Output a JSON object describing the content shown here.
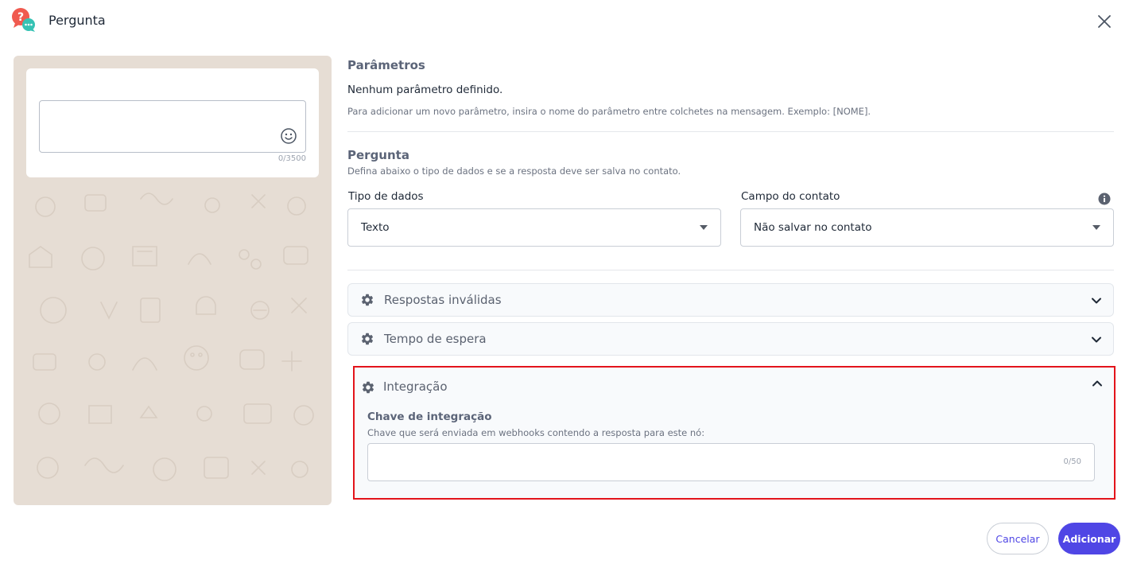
{
  "header": {
    "title": "Pergunta",
    "app_icon": "question-chat-icon",
    "close_icon": "close-icon"
  },
  "preview": {
    "message_counter": "0/3500",
    "emoji_icon": "smiley-icon"
  },
  "parameters": {
    "title": "Parâmetros",
    "empty_text": "Nenhum parâmetro definido.",
    "hint": "Para adicionar um novo parâmetro, insira o nome do parâmetro entre colchetes na mensagem. Exemplo: [NOME]."
  },
  "question": {
    "title": "Pergunta",
    "subtitle": "Defina abaixo o tipo de dados e se a resposta deve ser salva no contato.",
    "data_type": {
      "label": "Tipo de dados",
      "value": "Texto"
    },
    "contact_field": {
      "label": "Campo do contato",
      "value": "Não salvar no contato",
      "info_icon": "info-icon"
    }
  },
  "accordions": [
    {
      "label": "Respostas inválidas",
      "icon": "gear-icon"
    },
    {
      "label": "Tempo de espera",
      "icon": "gear-icon"
    }
  ],
  "integration": {
    "label": "Integração",
    "icon": "gear-icon",
    "key_title": "Chave de integração",
    "key_hint": "Chave que será enviada em webhooks contendo a resposta para este nó:",
    "key_value": "",
    "key_counter": "0/50"
  },
  "footer": {
    "cancel_label": "Cancelar",
    "add_label": "Adicionar"
  },
  "colors": {
    "accent": "#4f46e5",
    "highlight_border": "#e3141b",
    "preview_bg": "#e6ddd4"
  }
}
